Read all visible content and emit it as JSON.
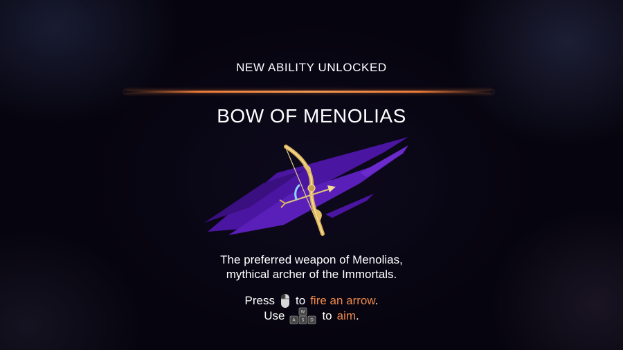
{
  "header": {
    "label": "NEW ABILITY UNLOCKED"
  },
  "ability": {
    "name": "BOW OF MENOLIAS",
    "description_lines": [
      "The preferred weapon of Menolias,",
      "mythical archer of the Immortals."
    ],
    "icon": "golden-bow-icon"
  },
  "controls": {
    "fire": {
      "prefix": "Press",
      "key_icon": "mouse-left-click-icon",
      "connector": "to",
      "action": "fire an arrow",
      "suffix": "."
    },
    "aim": {
      "prefix": "Use",
      "key_icon": "wasd-keys-icon",
      "keys": [
        "W",
        "A",
        "S",
        "D"
      ],
      "connector": "to",
      "action": "aim",
      "suffix": "."
    }
  },
  "colors": {
    "accent": "#f08a4b",
    "divider": "#e87a3a",
    "background": "#07050f",
    "purple_streak": "#5a1fb8",
    "bow_gold": "#d9b15a"
  }
}
